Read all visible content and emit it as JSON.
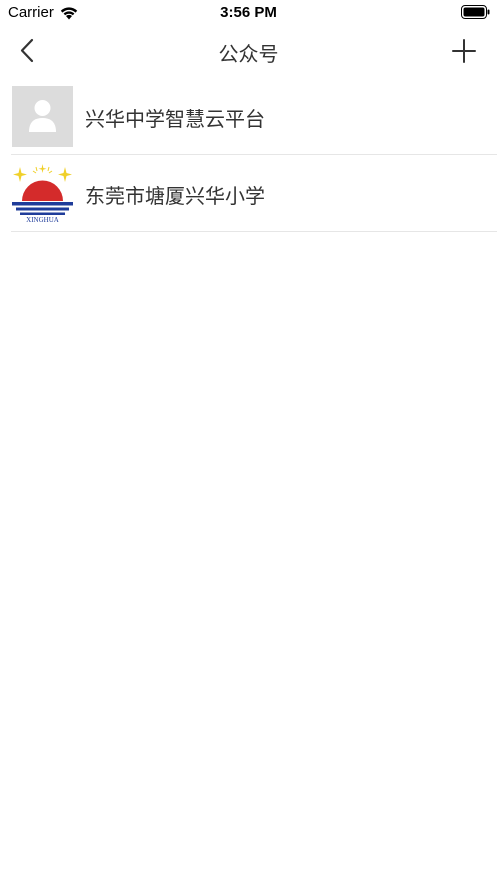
{
  "status_bar": {
    "carrier": "Carrier",
    "time": "3:56 PM",
    "wifi_icon": "wifi-icon",
    "battery_icon": "battery-full-icon"
  },
  "nav": {
    "title": "公众号",
    "back_icon": "chevron-left-icon",
    "add_icon": "plus-icon"
  },
  "accounts": [
    {
      "name": "兴华中学智慧云平台",
      "avatar": "default-user-avatar"
    },
    {
      "name": "东莞市塘厦兴华小学",
      "avatar": "school-logo",
      "logo_text": "XINGHUA"
    }
  ],
  "colors": {
    "text": "#333333",
    "divider": "#e6e6e6",
    "avatar_placeholder_bg": "#dcdcdc",
    "avatar_placeholder_fg": "#ffffff",
    "logo_red": "#d42b2b",
    "logo_blue": "#1f3c9a",
    "logo_star": "#f0d02a"
  }
}
